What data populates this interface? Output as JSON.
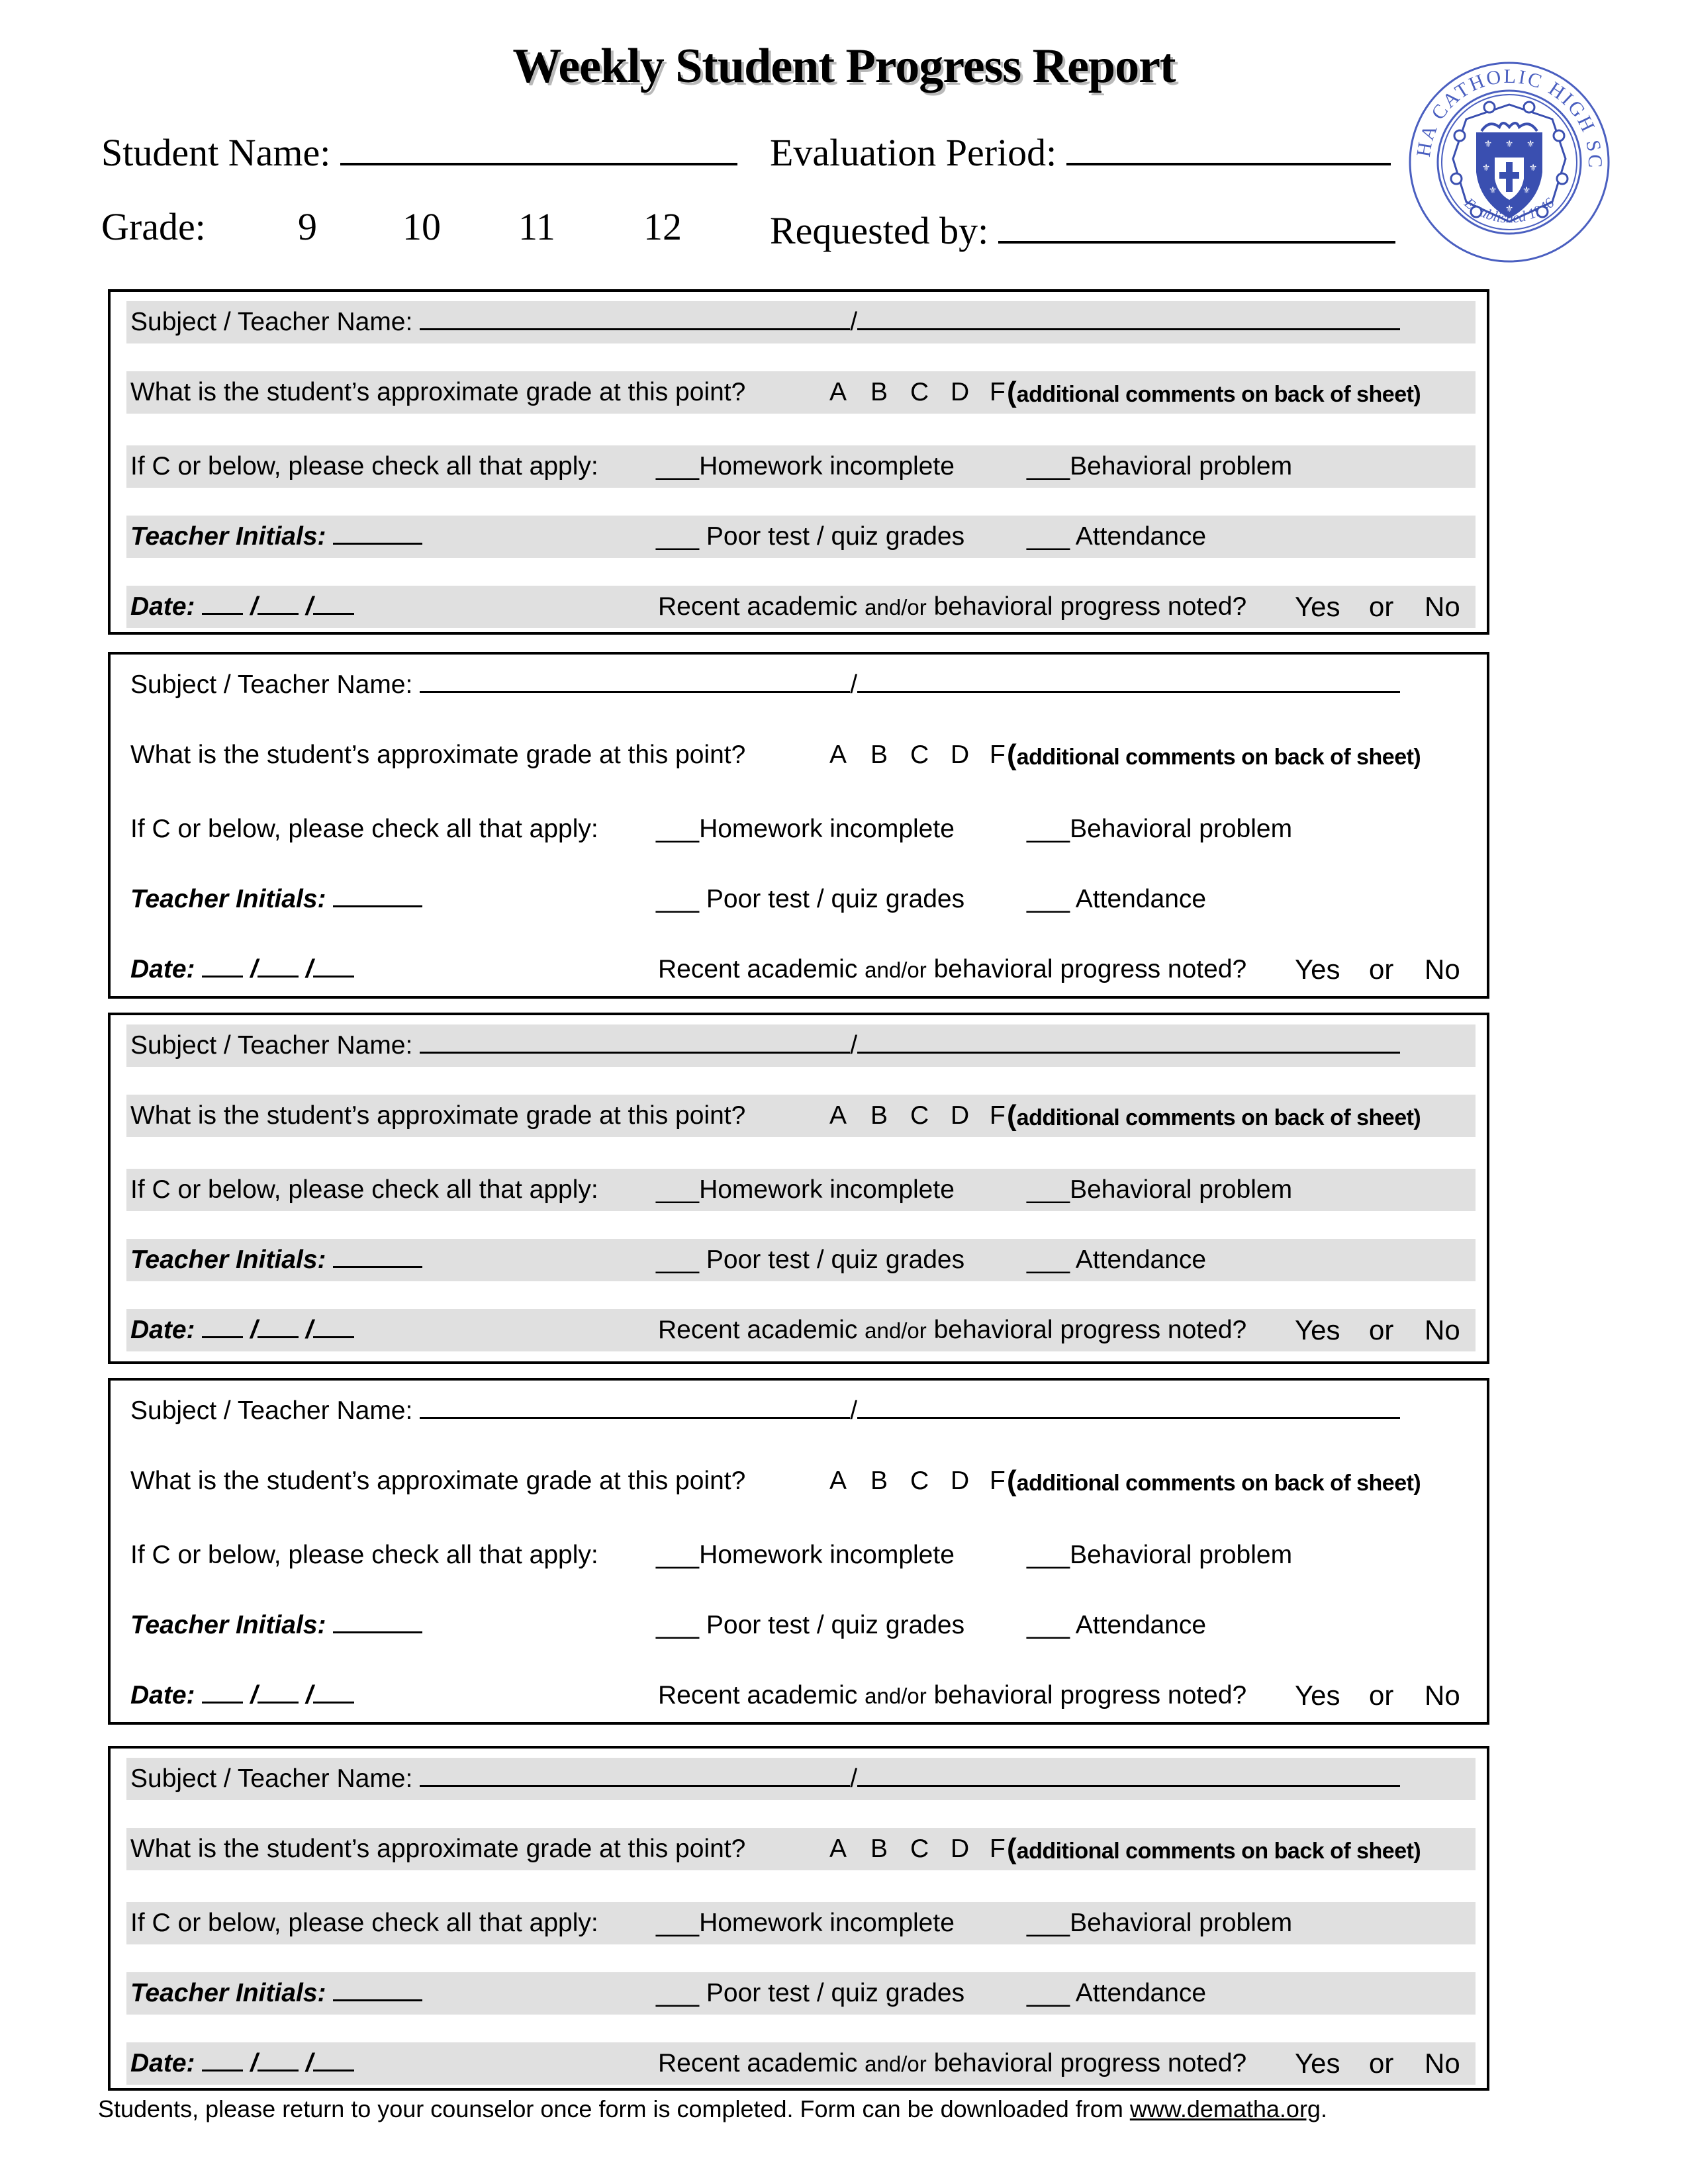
{
  "header": {
    "title": "Weekly Student Progress Report",
    "student_name_label": "Student Name:",
    "evaluation_period_label": "Evaluation Period:",
    "grade_label": "Grade:",
    "grade_options": [
      "9",
      "10",
      "11",
      "12"
    ],
    "requested_by_label": "Requested by:",
    "student_name_value": "",
    "evaluation_period_value": "",
    "requested_by_value": ""
  },
  "seal": {
    "icon": "school-seal-icon",
    "top_text": "DeMATHA CATHOLIC HIGH SCHOOL",
    "bottom_text": "Established 1946",
    "color": "#3a4fb0"
  },
  "form_labels": {
    "subject_teacher": "Subject / Teacher Name:",
    "slash": "/",
    "grade_question": "What is the student’s approximate grade at this point?",
    "grade_letters": [
      "A",
      "B",
      "C",
      "D",
      "F"
    ],
    "comments_note_paren": "(",
    "comments_note": "additional comments on back of sheet)",
    "check_prompt": "If C or below, please check all that apply:",
    "check_blank": "___",
    "homework": "Homework incomplete",
    "behavioral": "Behavioral problem",
    "teacher_initials": "Teacher Initials:",
    "poor_test": " Poor test / quiz grades",
    "attendance": " Attendance",
    "date_label": "Date:",
    "date_slash": "/",
    "progress_question_a": "Recent academic ",
    "progress_question_b": "and/or",
    "progress_question_c": " behavioral progress noted?",
    "yes": "Yes",
    "or": "or",
    "no": "No"
  },
  "sections": [
    {
      "shaded": true
    },
    {
      "shaded": false
    },
    {
      "shaded": true
    },
    {
      "shaded": false
    },
    {
      "shaded": true
    }
  ],
  "footer": {
    "text": "Students, please return to your counselor once form is completed.  Form can be downloaded from ",
    "link_text": "www.dematha.org",
    "trailing": "."
  },
  "colors": {
    "band_shade": "#e0e0e0",
    "seal_blue": "#3a4fb0"
  }
}
